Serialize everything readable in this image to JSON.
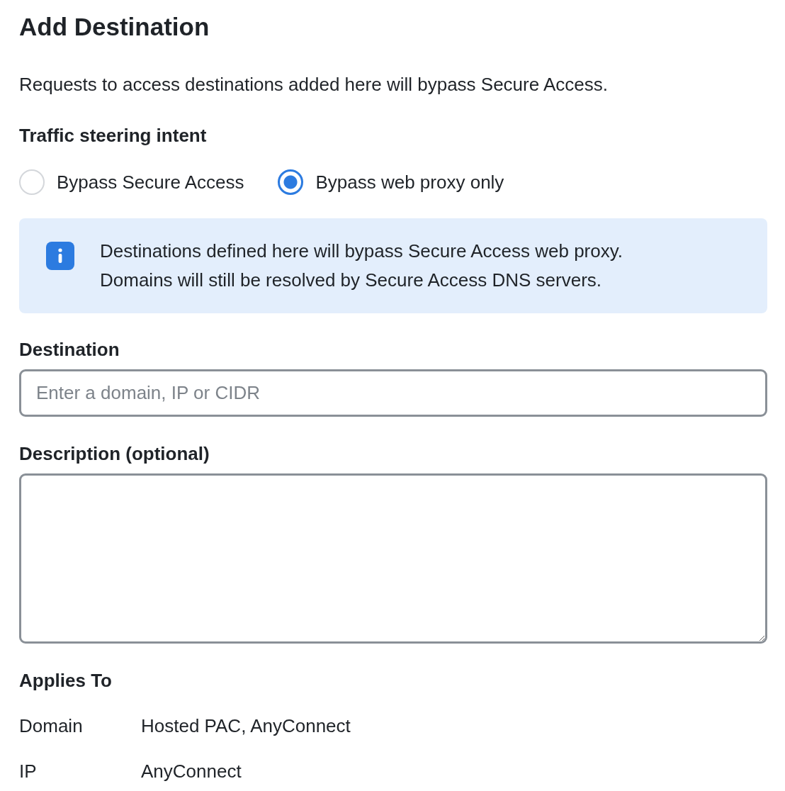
{
  "title": "Add Destination",
  "intro": "Requests to access destinations added here will bypass Secure Access.",
  "intent": {
    "label": "Traffic steering intent",
    "options": [
      {
        "label": "Bypass Secure Access",
        "selected": false
      },
      {
        "label": "Bypass web proxy only",
        "selected": true
      }
    ]
  },
  "info": {
    "lines": [
      "Destinations defined here will bypass Secure Access web proxy.",
      "Domains will still be resolved by Secure Access DNS servers."
    ]
  },
  "destination": {
    "label": "Destination",
    "placeholder": "Enter a domain, IP or CIDR"
  },
  "description": {
    "label": "Description (optional)"
  },
  "applies_to": {
    "label": "Applies To",
    "rows": [
      {
        "type": "Domain",
        "value": "Hosted PAC, AnyConnect"
      },
      {
        "type": "IP",
        "value": "AnyConnect"
      }
    ]
  }
}
